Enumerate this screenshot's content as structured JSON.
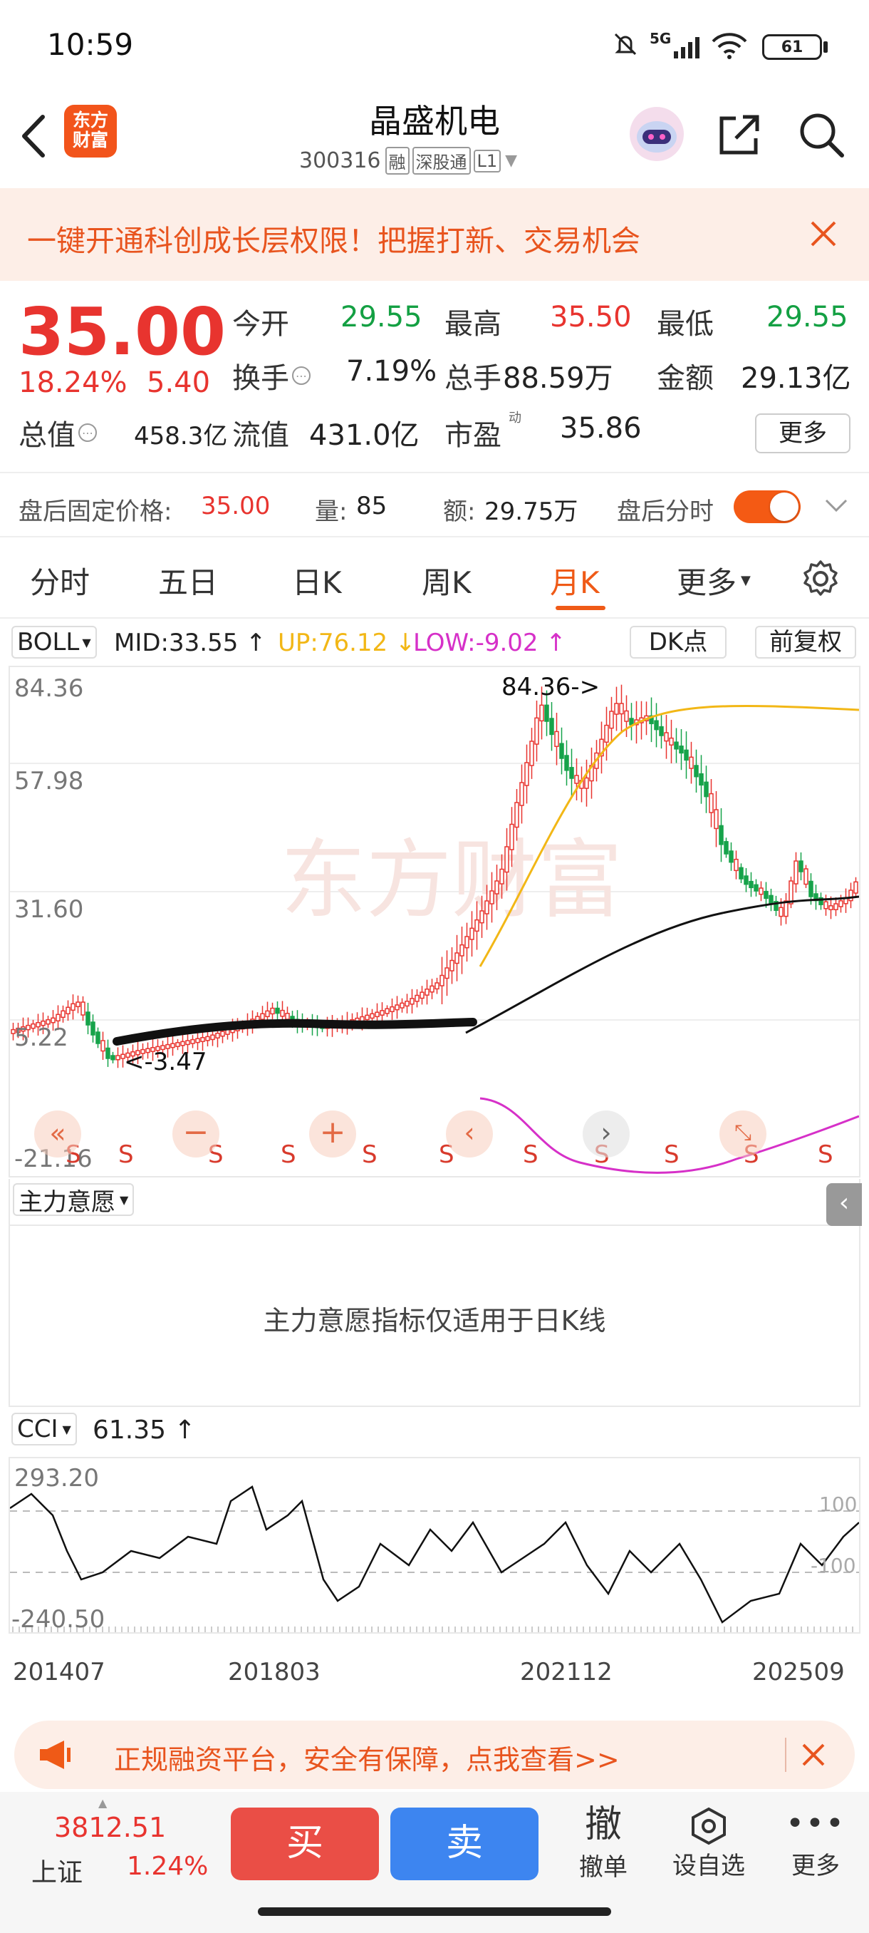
{
  "status_bar": {
    "time": "10:59",
    "network": "5G",
    "battery": "61"
  },
  "header": {
    "brand_line1": "东方",
    "brand_line2": "财富",
    "title": "晶盛机电",
    "code": "300316",
    "tag_margin": "融",
    "tag_connect": "深股通",
    "tag_level": "L1"
  },
  "banner": {
    "text": "一键开通科创成长层权限！把握打新、交易机会"
  },
  "quote": {
    "price": "35.00",
    "change_pct": "18.24%",
    "change": "5.40",
    "fields": [
      {
        "label": "今开",
        "value": "29.55"
      },
      {
        "label": "最高",
        "value": "35.50"
      },
      {
        "label": "最低",
        "value": "29.55"
      },
      {
        "label": "换手",
        "value": "7.19%"
      },
      {
        "label": "总手",
        "value": "88.59万"
      },
      {
        "label": "金额",
        "value": "29.13亿"
      },
      {
        "label": "总值",
        "value": "458.3亿"
      },
      {
        "label": "流值",
        "value": "431.0亿"
      },
      {
        "label": "市盈",
        "value": "35.86"
      }
    ],
    "pe_super": "动",
    "more_btn": "更多"
  },
  "after_hours": {
    "price_label": "盘后固定价格:",
    "price": "35.00",
    "vol_label": "量:",
    "vol": "85",
    "amt_label": "额:",
    "amt": "29.75万",
    "toggle_label": "盘后分时"
  },
  "tabs": [
    "分时",
    "五日",
    "日K",
    "周K",
    "月K",
    "更多"
  ],
  "active_tab": "月K",
  "boll": {
    "name": "BOLL",
    "mid": "MID:33.55",
    "up": "UP:76.12",
    "low": "LOW:-9.02",
    "dk_btn": "DK点",
    "adjust_btn": "前复权"
  },
  "chart_data": {
    "type": "candlestick",
    "y_ticks": [
      "84.36",
      "57.98",
      "31.60",
      "5.22",
      "-21.16"
    ],
    "max_label": "84.36->",
    "min_label": "<-3.47",
    "signals": [
      "S",
      "S",
      "S",
      "S",
      "S",
      "S",
      "S",
      "S",
      "S",
      "S",
      "S",
      "S"
    ],
    "x_labels": [
      "201407",
      "201803",
      "202112",
      "202509"
    ]
  },
  "zlyy": {
    "name": "主力意愿",
    "message": "主力意愿指标仅适用于日K线"
  },
  "cci": {
    "name": "CCI",
    "value": "61.35",
    "y_top": "293.20",
    "y_bottom": "-240.50",
    "level_high": "100",
    "level_low": "-100"
  },
  "ad": {
    "text": "正规融资平台，安全有保障，点我查看>>"
  },
  "bottom": {
    "index_value": "3812.51",
    "index_name": "上证",
    "index_pct": "1.24%",
    "buy": "买",
    "sell": "卖",
    "cancel_icon": "撤",
    "cancel": "撤单",
    "watch": "设自选",
    "more": "更多"
  }
}
